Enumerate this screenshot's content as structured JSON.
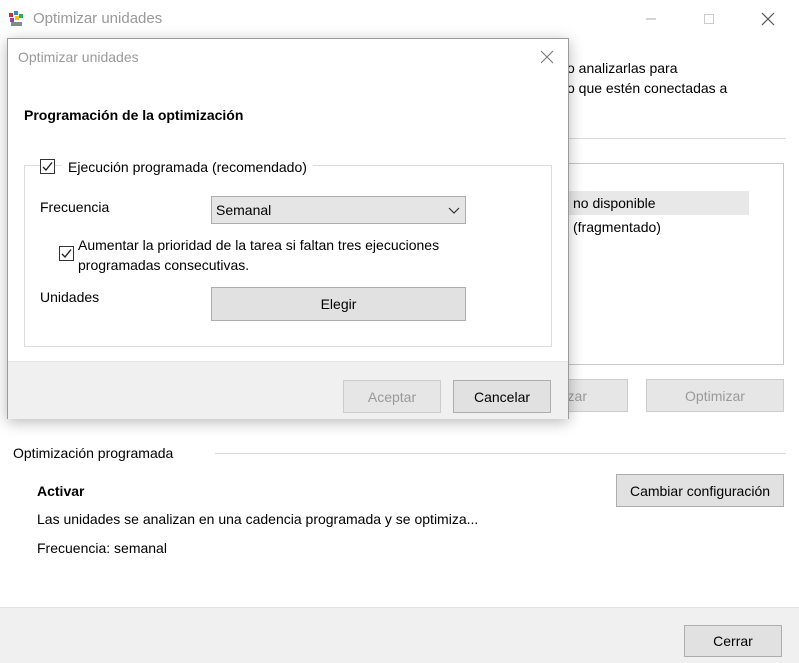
{
  "main_window": {
    "title": "Optimizar unidades",
    "description_line1": "o analizarlas para",
    "description_line2": "o que estén conectadas a",
    "drive_rows": [
      "no disponible",
      "(fragmentado)"
    ],
    "analyze_button_partial": "zar",
    "optimize_button": "Optimizar",
    "scheduled_section_label": "Optimización programada",
    "status_title": "Activar",
    "status_description": "Las unidades se analizan en una cadencia programada y se optimiza...",
    "frequency_status": "Frecuencia: semanal",
    "change_settings_button": "Cambiar configuración",
    "close_button": "Cerrar"
  },
  "dialog": {
    "title": "Optimizar unidades",
    "heading": "Programación de la optimización",
    "scheduled_run_label": "Ejecución programada (recomendado)",
    "scheduled_run_checked": true,
    "frequency_label": "Frecuencia",
    "frequency_value": "Semanal",
    "priority_label": "Aumentar la prioridad de la tarea si faltan tres ejecuciones programadas consecutivas.",
    "priority_checked": true,
    "units_label": "Unidades",
    "choose_button": "Elegir",
    "accept_button": "Aceptar",
    "cancel_button": "Cancelar"
  }
}
